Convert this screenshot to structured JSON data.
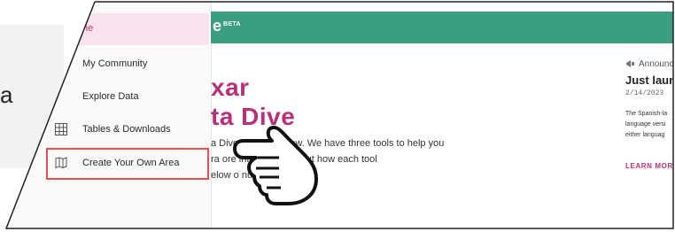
{
  "left_fragment": "a",
  "sidebar": {
    "items": [
      {
        "label": "ne",
        "active": true
      },
      {
        "label": "My Community"
      },
      {
        "label": "Explore Data"
      },
      {
        "label": "Tables & Downloads",
        "icon": "table-icon"
      },
      {
        "label": "Create Your Own Area",
        "icon": "map-add-icon",
        "highlighted": true
      }
    ]
  },
  "header": {
    "brand": "e",
    "badge": "BETA",
    "color": "#3b9e80"
  },
  "main": {
    "title_line1": "xar",
    "title_line2": "ta Dive",
    "paragraph_lines": [
      "a Dive, hoste    CI:Now. We have three tools to help you",
      "ra                 ore information about how each tool",
      "elow o            nu."
    ]
  },
  "announcement": {
    "label": "Announc",
    "title": "Just laun",
    "date": "2/14/2023",
    "body_lines": [
      "The Spanish-la",
      "language versi",
      "either languag"
    ],
    "link": "LEARN MOR"
  },
  "colors": {
    "accent": "#b8307a",
    "highlight_border": "#e35150",
    "active_bg": "#f8e3ec"
  }
}
